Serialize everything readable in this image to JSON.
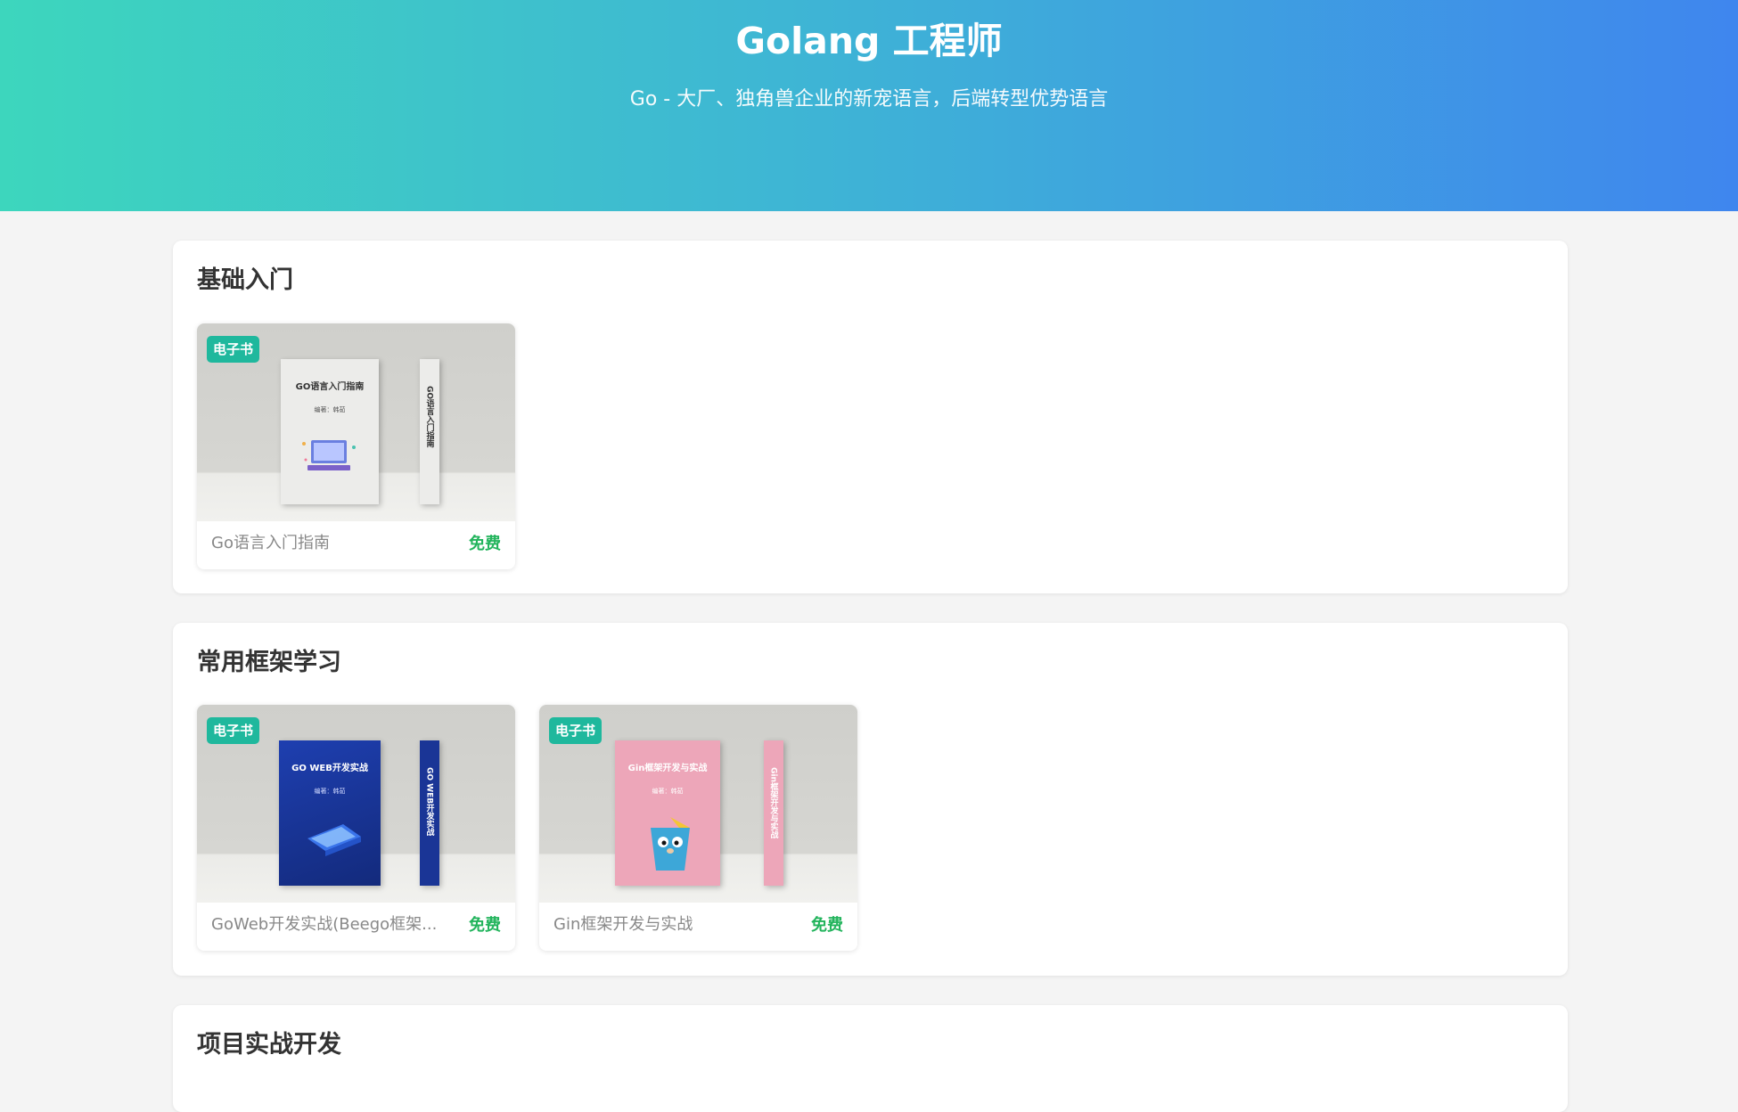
{
  "header": {
    "title": "Golang 工程师",
    "subtitle": "Go - 大厂、独角兽企业的新宠语言，后端转型优势语言"
  },
  "sections": [
    {
      "title": "基础入门",
      "cards": [
        {
          "badge": "电子书",
          "cover_title": "GO语言入门指南",
          "cover_author": "编著：韩茹",
          "spine": "GO语言入门指南",
          "name": "Go语言入门指南",
          "price": "免费",
          "cover_color": "#e9e9e6",
          "text_color": "#333333"
        }
      ]
    },
    {
      "title": "常用框架学习",
      "cards": [
        {
          "badge": "电子书",
          "cover_title": "GO WEB开发实战",
          "cover_author": "编著：韩茹",
          "spine": "GO WEB开发实战",
          "name": "GoWeb开发实战(Beego框架...",
          "price": "免费",
          "cover_color": "#1c3a9e",
          "text_color": "#ffffff"
        },
        {
          "badge": "电子书",
          "cover_title": "Gin框架开发与实战",
          "cover_author": "编著：韩茹",
          "spine": "Gin框架开发与实战",
          "name": "Gin框架开发与实战",
          "price": "免费",
          "cover_color": "#eda6b9",
          "text_color": "#ffffff"
        }
      ]
    },
    {
      "title": "项目实战开发",
      "cards": []
    }
  ]
}
